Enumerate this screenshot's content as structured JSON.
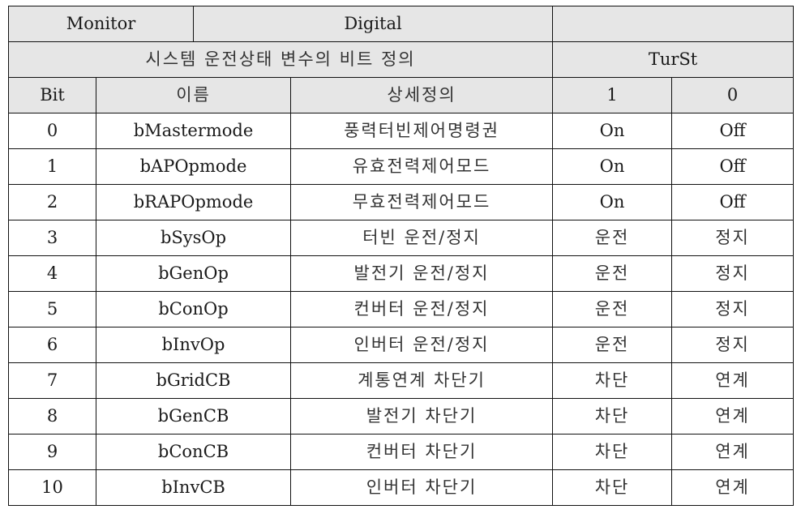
{
  "header": {
    "monitor_label": "Monitor",
    "type_label": "Digital",
    "top_right": "",
    "title": "시스템 운전상태 변수의 비트 정의",
    "variable_name": "TurSt"
  },
  "columns": {
    "bit": "Bit",
    "name": "이름",
    "detail": "상세정의",
    "val1": "1",
    "val0": "0"
  },
  "rows": [
    {
      "bit": "0",
      "name": "bMastermode",
      "detail": "풍력터빈제어명령권",
      "v1": "On",
      "v0": "Off"
    },
    {
      "bit": "1",
      "name": "bAPOpmode",
      "detail": "유효전력제어모드",
      "v1": "On",
      "v0": "Off"
    },
    {
      "bit": "2",
      "name": "bRAPOpmode",
      "detail": "무효전력제어모드",
      "v1": "On",
      "v0": "Off"
    },
    {
      "bit": "3",
      "name": "bSysOp",
      "detail": "터빈 운전/정지",
      "v1": "운전",
      "v0": "정지"
    },
    {
      "bit": "4",
      "name": "bGenOp",
      "detail": "발전기 운전/정지",
      "v1": "운전",
      "v0": "정지"
    },
    {
      "bit": "5",
      "name": "bConOp",
      "detail": "컨버터 운전/정지",
      "v1": "운전",
      "v0": "정지"
    },
    {
      "bit": "6",
      "name": "bInvOp",
      "detail": "인버터 운전/정지",
      "v1": "운전",
      "v0": "정지"
    },
    {
      "bit": "7",
      "name": "bGridCB",
      "detail": "계통연계 차단기",
      "v1": "차단",
      "v0": "연계"
    },
    {
      "bit": "8",
      "name": "bGenCB",
      "detail": "발전기 차단기",
      "v1": "차단",
      "v0": "연계"
    },
    {
      "bit": "9",
      "name": "bConCB",
      "detail": "컨버터 차단기",
      "v1": "차단",
      "v0": "연계"
    },
    {
      "bit": "10",
      "name": "bInvCB",
      "detail": "인버터 차단기",
      "v1": "차단",
      "v0": "연계"
    }
  ]
}
